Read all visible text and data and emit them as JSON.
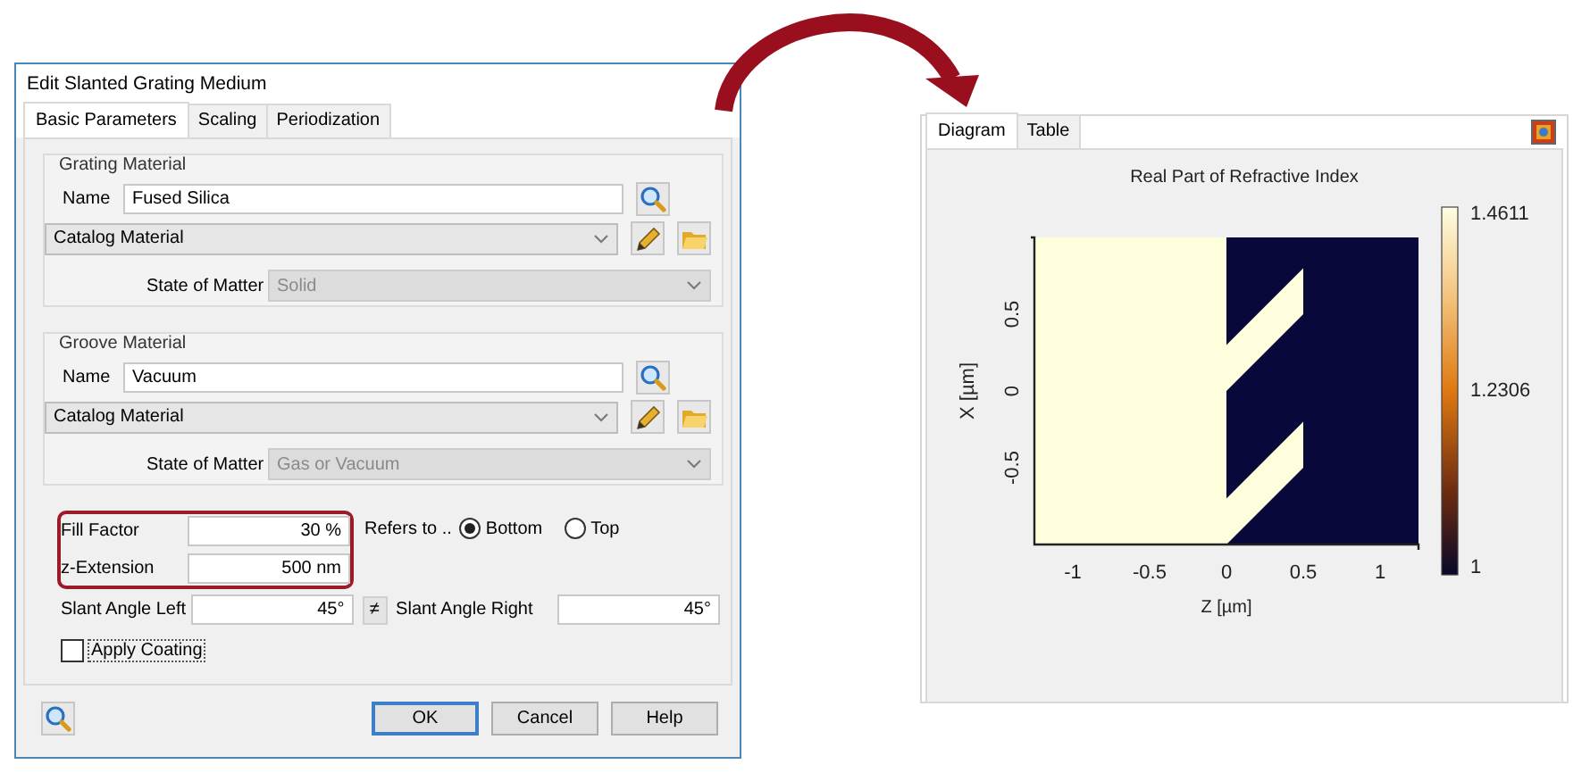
{
  "dialog": {
    "title": "Edit Slanted Grating Medium",
    "tabs": [
      {
        "label": "Basic Parameters",
        "selected": true
      },
      {
        "label": "Scaling",
        "selected": false
      },
      {
        "label": "Periodization",
        "selected": false
      }
    ],
    "groups": [
      {
        "legend": "Grating Material",
        "name_label": "Name",
        "name_value": "Fused Silica",
        "material_type": "Catalog Material",
        "state_label": "State of Matter",
        "state_value": "Solid",
        "state_disabled": true
      },
      {
        "legend": "Groove Material",
        "name_label": "Name",
        "name_value": "Vacuum",
        "material_type": "Catalog Material",
        "state_label": "State of Matter",
        "state_value": "Gas or Vacuum",
        "state_disabled": true
      }
    ],
    "highlight": true,
    "fill_factor": {
      "label": "Fill Factor",
      "value": "30 %"
    },
    "z_extension": {
      "label": "z-Extension",
      "value": "500 nm"
    },
    "refers_to": {
      "label": "Refers to ..",
      "options": [
        {
          "label": "Bottom",
          "selected": true
        },
        {
          "label": "Top",
          "selected": false
        }
      ]
    },
    "slant_left": {
      "label": "Slant Angle Left",
      "value": "45°"
    },
    "link_button": "≠",
    "slant_right": {
      "label": "Slant Angle Right",
      "value": "45°"
    },
    "apply_coating": {
      "label": "Apply Coating",
      "checked": false
    },
    "buttons": [
      {
        "label": "OK",
        "default": true
      },
      {
        "label": "Cancel",
        "default": false
      },
      {
        "label": "Help",
        "default": false
      }
    ]
  },
  "viewer": {
    "tabs": [
      {
        "label": "Diagram",
        "selected": true
      },
      {
        "label": "Table",
        "selected": false
      }
    ],
    "plot": {
      "title": "Real Part of Refractive Index",
      "xlabel": "Z [µm]",
      "ylabel": "X [µm]",
      "xtick_labels": [
        "-1",
        "-0.5",
        "0",
        "0.5",
        "1"
      ],
      "ytick_labels": [
        "0.5",
        "0",
        "-0.5"
      ],
      "colorbar_labels": [
        "1.4611",
        "1.2306",
        "1"
      ]
    }
  }
}
